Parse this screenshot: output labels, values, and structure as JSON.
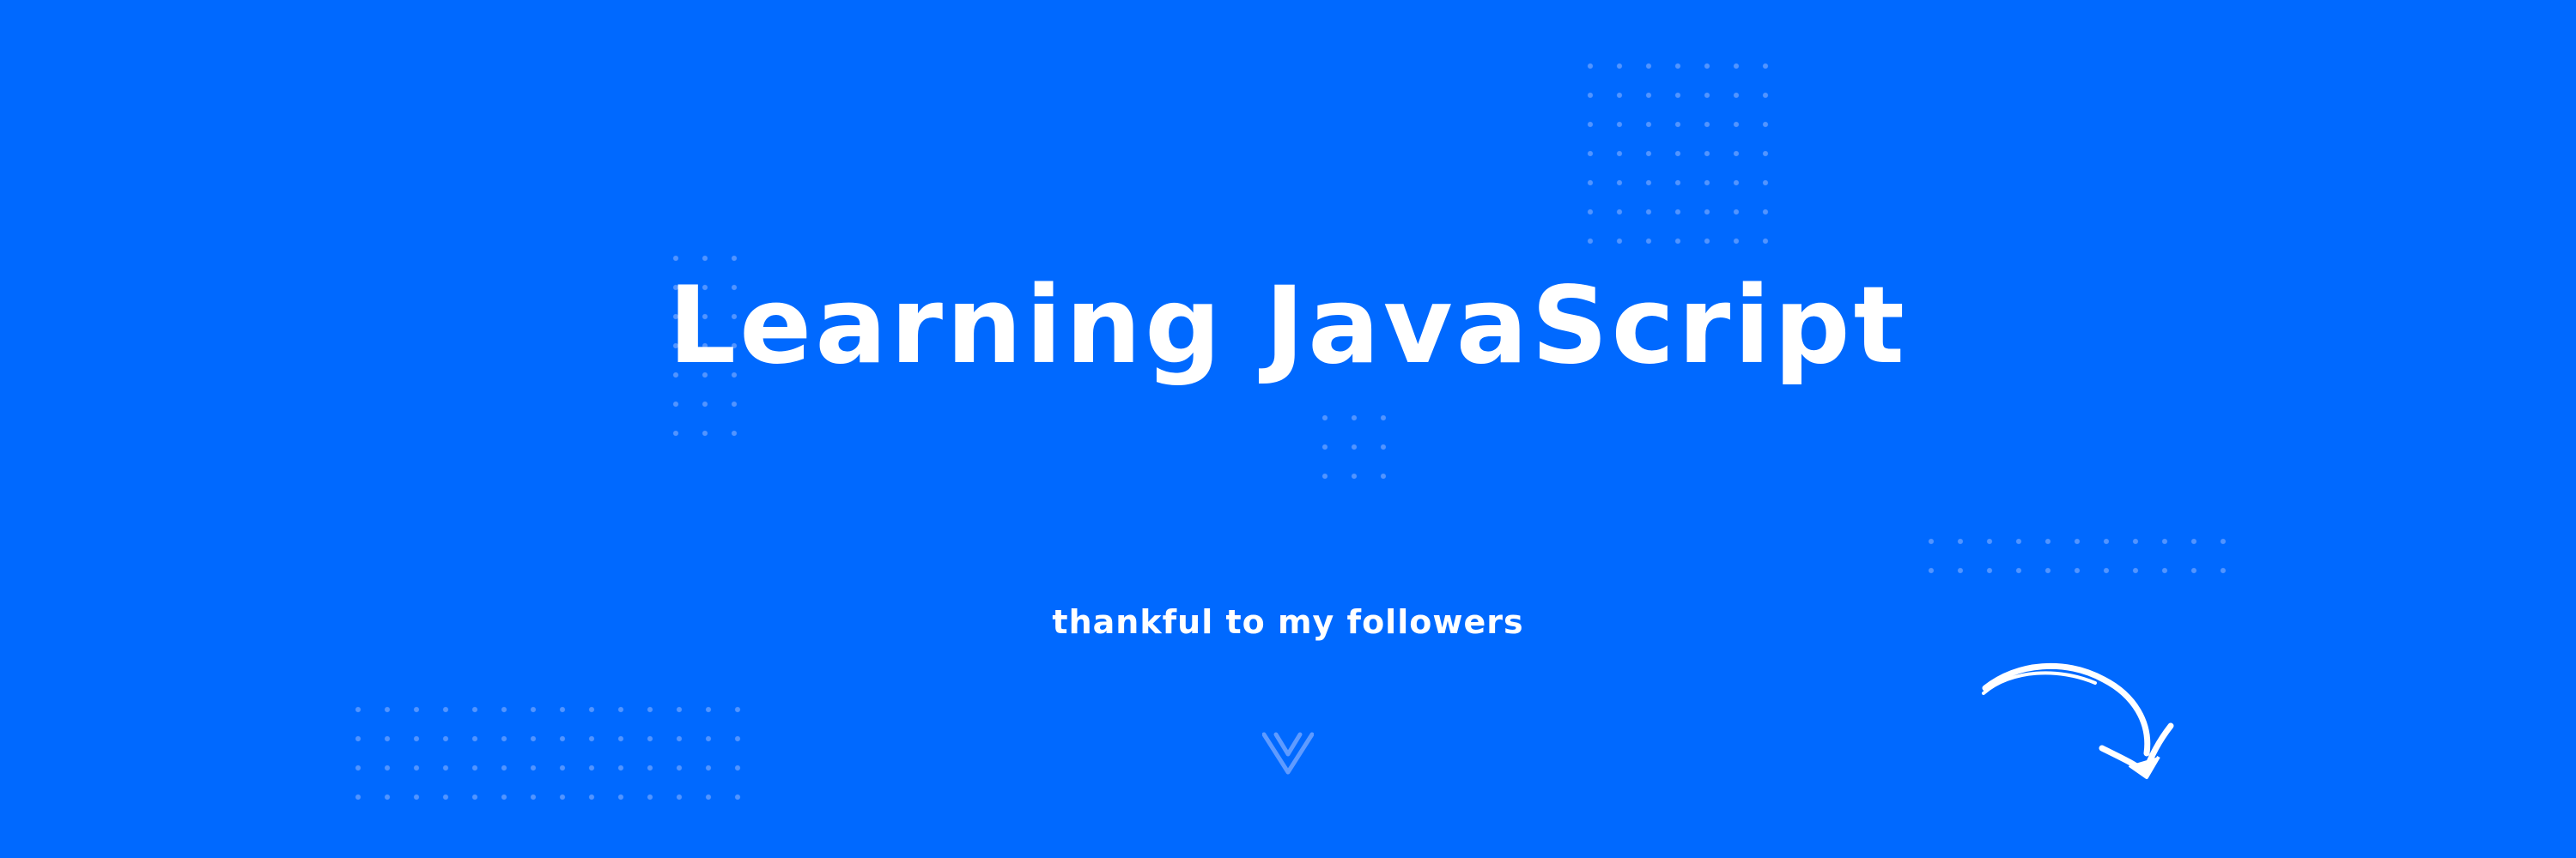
{
  "banner": {
    "title": "Learning JavaScript",
    "subtitle": "thankful to my followers",
    "background_color": "#0069ff",
    "text_color": "#ffffff",
    "dot_color": "#7fa8ff",
    "logo_icon": "v-logo-icon",
    "arrow_icon": "curved-arrow-icon"
  }
}
